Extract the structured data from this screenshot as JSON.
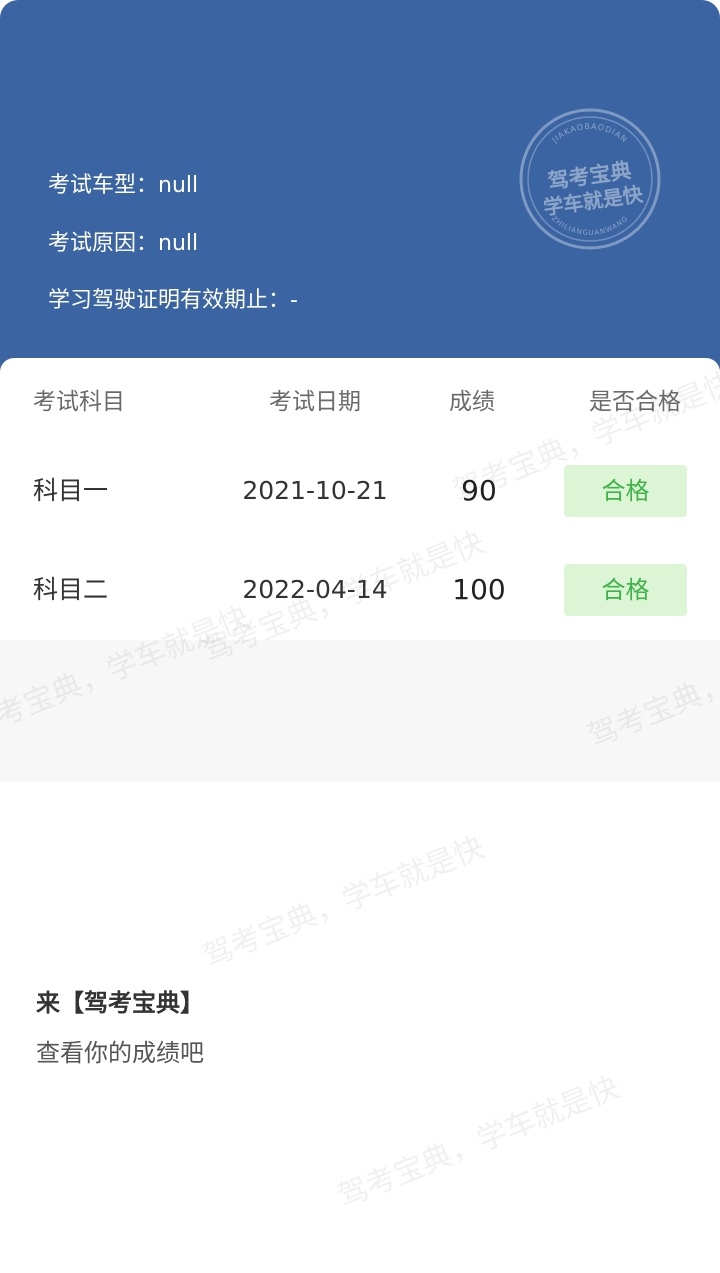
{
  "header": {
    "vehicle_type_label": "考试车型：",
    "vehicle_type_value": "null",
    "reason_label": "考试原因：",
    "reason_value": "null",
    "validity_label": "学习驾驶证明有效期止：",
    "validity_value": "-",
    "background_color": "#3b64a2"
  },
  "seal": {
    "top_arc": "JIAKAOBAODIAN",
    "line1": "驾考宝典",
    "line2": "学车就是快",
    "bottom_arc": "ZHILIANGUANWANG"
  },
  "table": {
    "columns": [
      "考试科目",
      "考试日期",
      "成绩",
      "是否合格"
    ],
    "rows": [
      {
        "subject": "科目一",
        "date": "2021-10-21",
        "score": "90",
        "result": "合格"
      },
      {
        "subject": "科目二",
        "date": "2022-04-14",
        "score": "100",
        "result": "合格"
      }
    ],
    "pass_color": "#3fb24a",
    "pass_bg_color": "#dcf5d4"
  },
  "promo": {
    "title": "来【驾考宝典】",
    "subtitle": "查看你的成绩吧"
  },
  "watermark": {
    "text": "驾考宝典，学车就是快"
  }
}
